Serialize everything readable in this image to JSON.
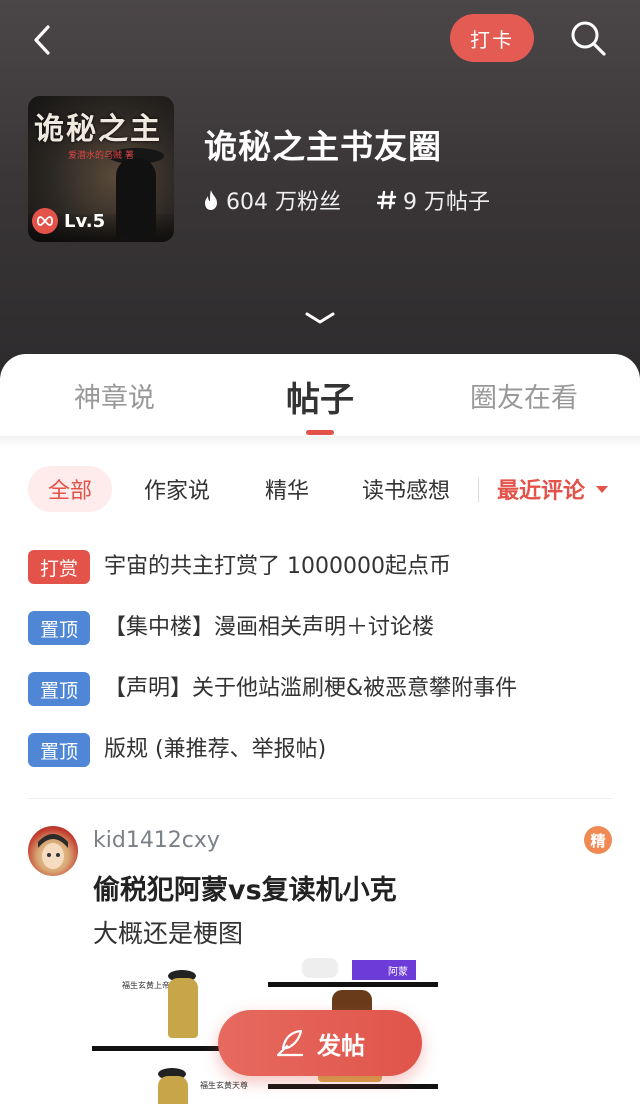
{
  "header": {
    "checkin_label": "打卡",
    "circle_title": "诡秘之主书友圈",
    "fans": "604 万粉丝",
    "posts": "9 万帖子",
    "level": "Lv.5",
    "cover_title": "诡秘之主",
    "cover_subtitle": "爱潜水的乌贼 著"
  },
  "tabs": [
    {
      "label": "神章说"
    },
    {
      "label": "帖子"
    },
    {
      "label": "圈友在看"
    }
  ],
  "filters": [
    {
      "label": "全部"
    },
    {
      "label": "作家说"
    },
    {
      "label": "精华"
    },
    {
      "label": "读书感想"
    }
  ],
  "sort_label": "最近评论",
  "pinned": [
    {
      "tag": "打赏",
      "text": "宇宙的共主打赏了 1000000起点币"
    },
    {
      "tag": "置顶",
      "text": "【集中楼】漫画相关声明＋讨论楼"
    },
    {
      "tag": "置顶",
      "text": "【声明】关于他站滥刷梗&被恶意攀附事件"
    },
    {
      "tag": "置顶",
      "text": "版规 (兼推荐、举报帖)"
    }
  ],
  "post": {
    "username": "kid1412cxy",
    "badge": "精",
    "title": "偷税犯阿蒙vs复读机小克",
    "body": "大概还是梗图",
    "image_tag": "阿蒙",
    "image_captions": [
      "福生玄黄上帝",
      "福生玄黄天尊"
    ]
  },
  "fab_label": "发帖",
  "colors": {
    "accent": "#e3534a",
    "pin_blue": "#4f86d6",
    "header_bg": "#3a3638"
  }
}
